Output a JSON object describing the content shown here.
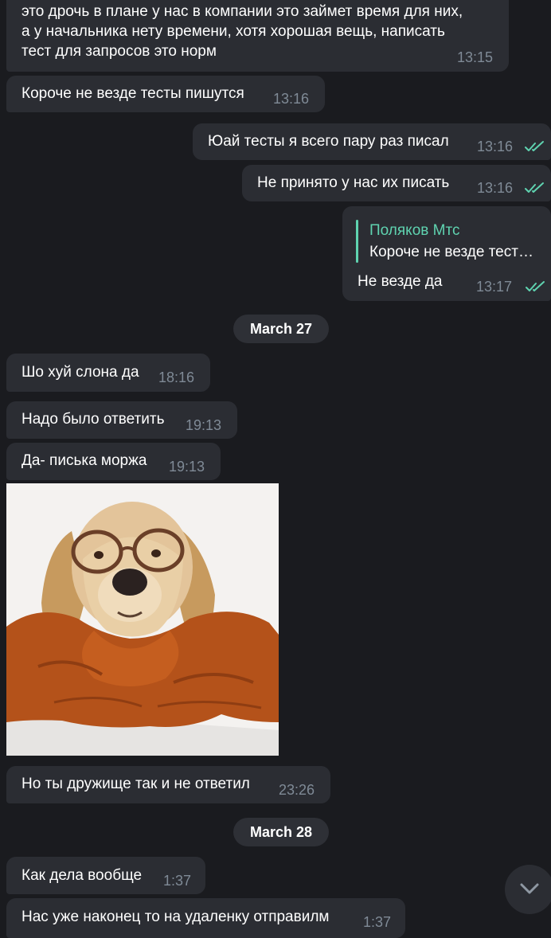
{
  "messages": [
    {
      "text": "это дрочь в плане у нас в компании это займет время для них,\nа у начальника нету времени, хотя хорошая вещь, написать\nтест для запросов это норм",
      "time": "13:15"
    },
    {
      "text": "Короче не везде тесты пишутся",
      "time": "13:16"
    },
    {
      "text": "Юай тесты я всего пару раз писал",
      "time": "13:16"
    },
    {
      "text": "Не принято у нас их писать",
      "time": "13:16"
    },
    {
      "reply_name": "Поляков Мтс",
      "reply_text": "Короче не везде тест…",
      "text": "Не везде да",
      "time": "13:17"
    },
    {
      "text": "Шо хуй слона да",
      "time": "18:16"
    },
    {
      "text": "Надо было ответить",
      "time": "19:13"
    },
    {
      "text": "Да- писька моржа",
      "time": "19:13"
    },
    {
      "text": "Но ты дружище так и не ответил",
      "time": "23:26"
    },
    {
      "text": "Как дела вообще",
      "time": "1:37"
    },
    {
      "text": "Нас уже наконец то на удаленку отправилм",
      "time": "1:37"
    }
  ],
  "dates": [
    "March 27",
    "March 28"
  ],
  "icons": {
    "read_ticks": "double-check-icon",
    "scroll_down": "chevron-down-icon"
  },
  "colors": {
    "background": "#1a1b1f",
    "bubble": "#2b2d33",
    "accent": "#5fd3b0",
    "time": "#7f8a96"
  }
}
